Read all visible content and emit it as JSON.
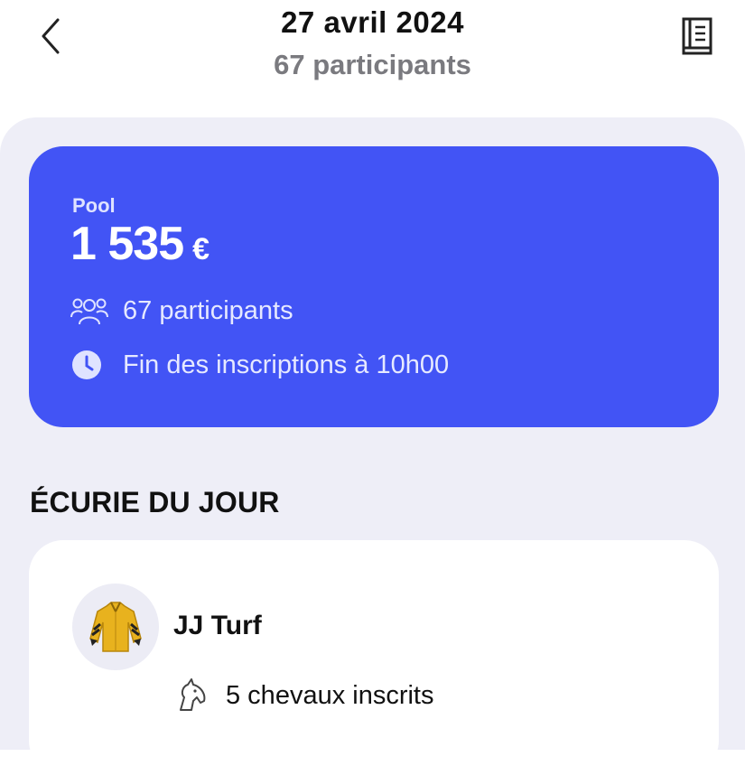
{
  "header": {
    "title": "27 avril 2024",
    "subtitle": "67 participants"
  },
  "pool": {
    "label": "Pool",
    "amount": "1 535",
    "currency": "€",
    "participants_text": "67 participants",
    "deadline_text": "Fin des inscriptions à 10h00"
  },
  "section": {
    "title": "ÉCURIE DU JOUR"
  },
  "stable": {
    "name": "JJ Turf",
    "horses_text": "5 chevaux inscrits"
  },
  "icons": {
    "back": "chevron-left-icon",
    "rules": "book-icon",
    "participants": "users-icon",
    "deadline": "clock-icon",
    "jersey": "jockey-jacket-icon",
    "horse": "horse-head-icon"
  },
  "colors": {
    "accent": "#4254f5",
    "sheet_background": "#eeeef7",
    "jersey_yellow": "#e8b21e"
  }
}
